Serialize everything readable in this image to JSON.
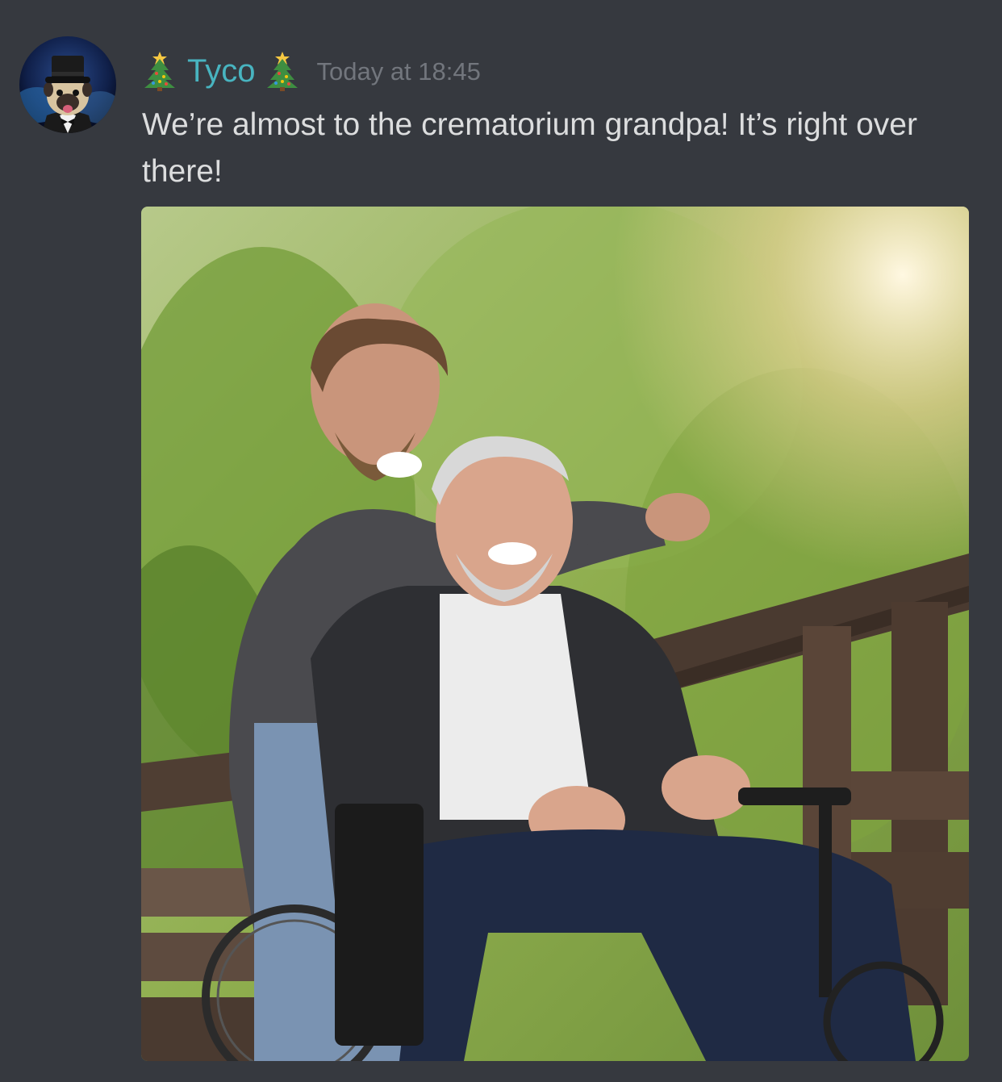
{
  "message": {
    "author": "Tyco",
    "timestamp": "Today at 18:45",
    "text": "We’re almost to the crematorium grandpa! It’s right over there!",
    "author_decoration_icon": "christmas-tree-icon"
  },
  "colors": {
    "background": "#36393f",
    "username": "#48b4c0",
    "timestamp": "#72767d",
    "text": "#dcddde"
  }
}
